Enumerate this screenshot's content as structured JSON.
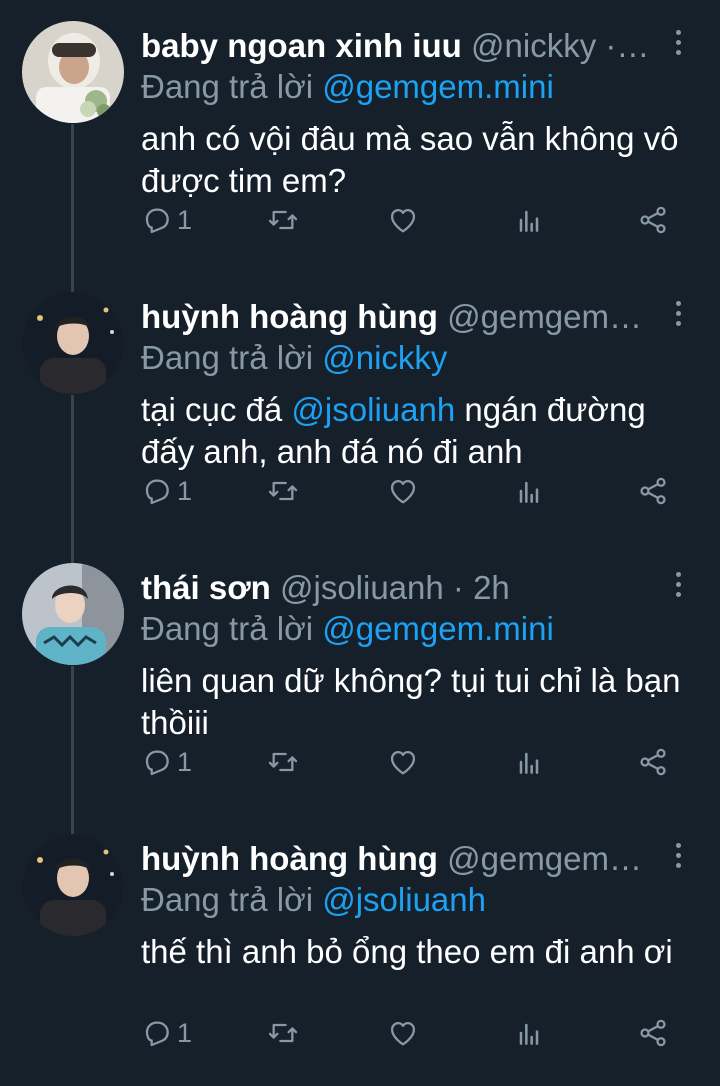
{
  "tweets": [
    {
      "name": "baby ngoan xinh iuu",
      "handle_meta": "@nickky ·…",
      "reply_prefix": "Đang trả lời ",
      "reply_to": "@gemgem.mini",
      "body_before": "anh có vội đâu mà sao vẫn không vô được tim em?",
      "mention": "",
      "body_after": "",
      "reply_count": "1"
    },
    {
      "name": "huỳnh hoàng hùng",
      "handle_meta": "@gemgem…",
      "reply_prefix": "Đang trả lời ",
      "reply_to": "@nickky",
      "body_before": "tại cục đá ",
      "mention": "@jsoliuanh",
      "body_after": " ngán đường đấy anh, anh đá nó đi anh",
      "reply_count": "1"
    },
    {
      "name": "thái sơn",
      "handle_meta": "@jsoliuanh · 2h",
      "reply_prefix": "Đang trả lời ",
      "reply_to": "@gemgem.mini",
      "body_before": "liên quan dữ không? tụi tui chỉ là bạn thồiii",
      "mention": "",
      "body_after": "",
      "reply_count": "1"
    },
    {
      "name": "huỳnh hoàng hùng",
      "handle_meta": "@gemgem…",
      "reply_prefix": "Đang trả lời ",
      "reply_to": "@jsoliuanh",
      "body_before": "thế thì anh bỏ ổng theo em đi anh ơi",
      "mention": "",
      "body_after": "",
      "reply_count": "1"
    }
  ],
  "icons": {
    "reply": "reply-icon",
    "retweet": "retweet-icon",
    "like": "heart-icon",
    "analytics": "analytics-icon",
    "share": "share-icon",
    "more": "more-vertical-icon"
  },
  "colors": {
    "background": "#15202b",
    "text": "#ffffff",
    "muted": "#8899a6",
    "accent": "#1da1f2",
    "thread_line": "#38444d"
  }
}
